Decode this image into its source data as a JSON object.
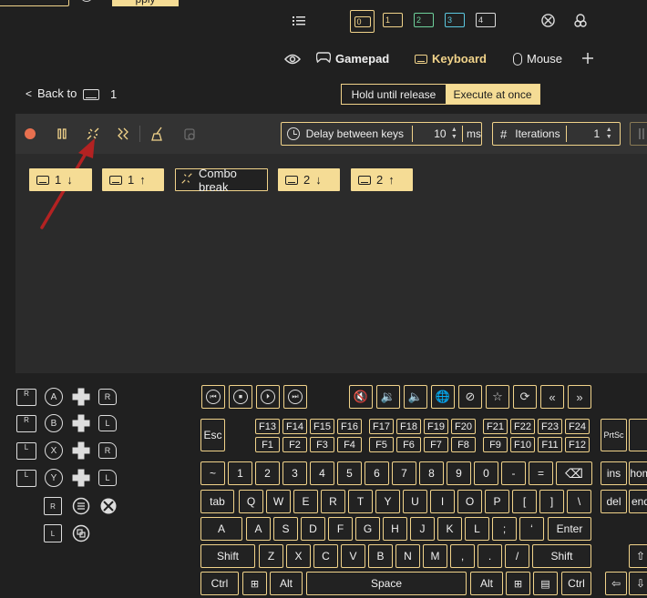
{
  "top_bar": {
    "ghost_button": "",
    "apply_button": "pply"
  },
  "profile_tabs": [
    "0",
    "1",
    "2",
    "3",
    "4"
  ],
  "mode_tabs": {
    "gamepad": "Gamepad",
    "keyboard": "Keyboard",
    "mouse": "Mouse"
  },
  "nav": {
    "back": "Back to",
    "profile_number": "1"
  },
  "release_mode": {
    "hold": "Hold until release",
    "execute": "Execute at once"
  },
  "toolbar": {
    "delay_label": "Delay between keys",
    "delay_value": "10",
    "delay_unit": "ms",
    "iterations_label": "Iterations",
    "iterations_value": "1"
  },
  "sequence": [
    {
      "key": "1",
      "dir": "down"
    },
    {
      "key": "1",
      "dir": "up"
    },
    {
      "key": "Combo break",
      "dir": ""
    },
    {
      "key": "2",
      "dir": "down"
    },
    {
      "key": "2",
      "dir": "up"
    }
  ],
  "gamepad_buttons": {
    "a": "A",
    "b": "B",
    "x": "X",
    "y": "Y",
    "r": "R",
    "l": "L"
  },
  "keyboard": {
    "esc": "Esc",
    "f_top": [
      "F13",
      "F14",
      "F15",
      "F16",
      "F17",
      "F18",
      "F19",
      "F20",
      "F21",
      "F22",
      "F23",
      "F24"
    ],
    "f_bottom": [
      "F1",
      "F2",
      "F3",
      "F4",
      "F5",
      "F6",
      "F7",
      "F8",
      "F9",
      "F10",
      "F11",
      "F12"
    ],
    "prtsc": "PrtSc",
    "num_row": [
      "~",
      "1",
      "2",
      "3",
      "4",
      "5",
      "6",
      "7",
      "8",
      "9",
      "0",
      "-",
      "="
    ],
    "ins": "ins",
    "home": "hom",
    "tab": "tab",
    "q_row": [
      "Q",
      "W",
      "E",
      "R",
      "T",
      "Y",
      "U",
      "I",
      "O",
      "P",
      "[",
      "]",
      "\\"
    ],
    "del": "del",
    "end": "end",
    "caps": "A",
    "a_row": [
      "A",
      "S",
      "D",
      "F",
      "G",
      "H",
      "J",
      "K",
      "L",
      ";",
      "‘"
    ],
    "enter": "Enter",
    "shift_l": "Shift",
    "z_row": [
      "Z",
      "X",
      "C",
      "V",
      "B",
      "N",
      "M",
      ",",
      ".",
      "/"
    ],
    "shift_r": "Shift",
    "ctrl_l": "Ctrl",
    "alt_l": "Alt",
    "space": "Space",
    "alt_r": "Alt",
    "ctrl_r": "Ctrl"
  },
  "colors": {
    "accent": "#f1d38a",
    "chip": "#f5dc95",
    "record": "#e8704f",
    "background": "#202020",
    "panel": "#2b2b2b"
  }
}
